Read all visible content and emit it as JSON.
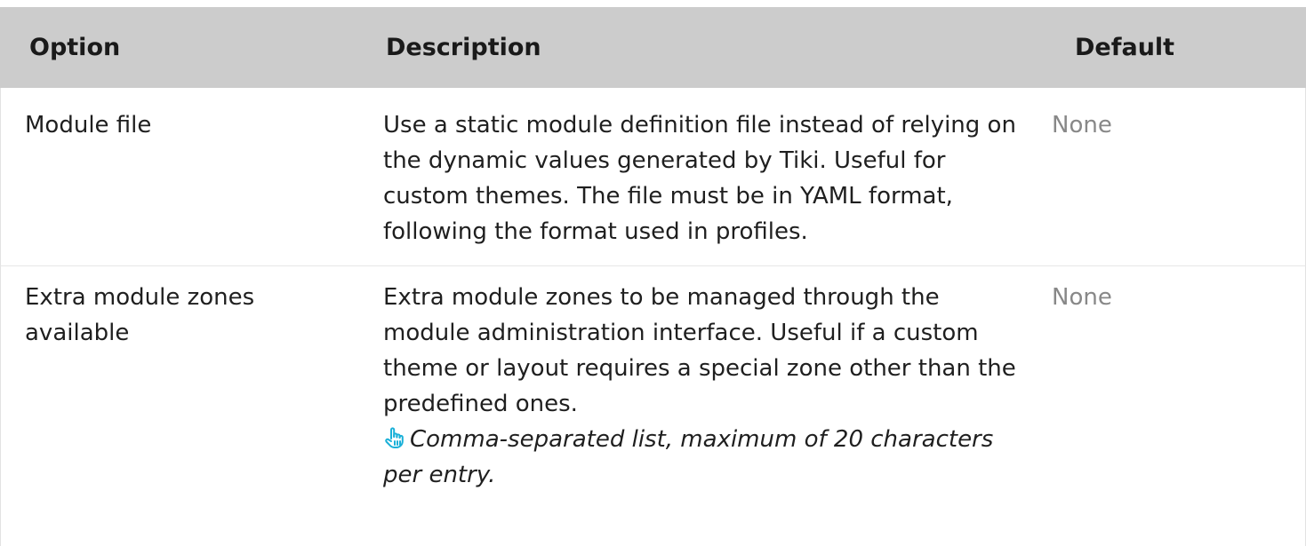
{
  "headers": {
    "option": "Option",
    "description": "Description",
    "default": "Default"
  },
  "rows": [
    {
      "option": "Module file",
      "description": "Use a static module definition file instead of relying on the dynamic values generated by Tiki. Useful for custom themes. The file must be in YAML format, following the format used in profiles.",
      "default": "None"
    },
    {
      "option": "Extra module zones available",
      "description": "Extra module zones to be managed through the module administration interface. Useful if a custom theme or layout requires a special zone other than the predefined ones.",
      "hint": "Comma-separated list, maximum of 20 characters per entry.",
      "hint_icon": "pointing-hand-icon",
      "default": "None"
    }
  ],
  "colors": {
    "header_bg": "#cccccc",
    "default_text": "#888888",
    "hint_icon": "#1ab0d8"
  }
}
